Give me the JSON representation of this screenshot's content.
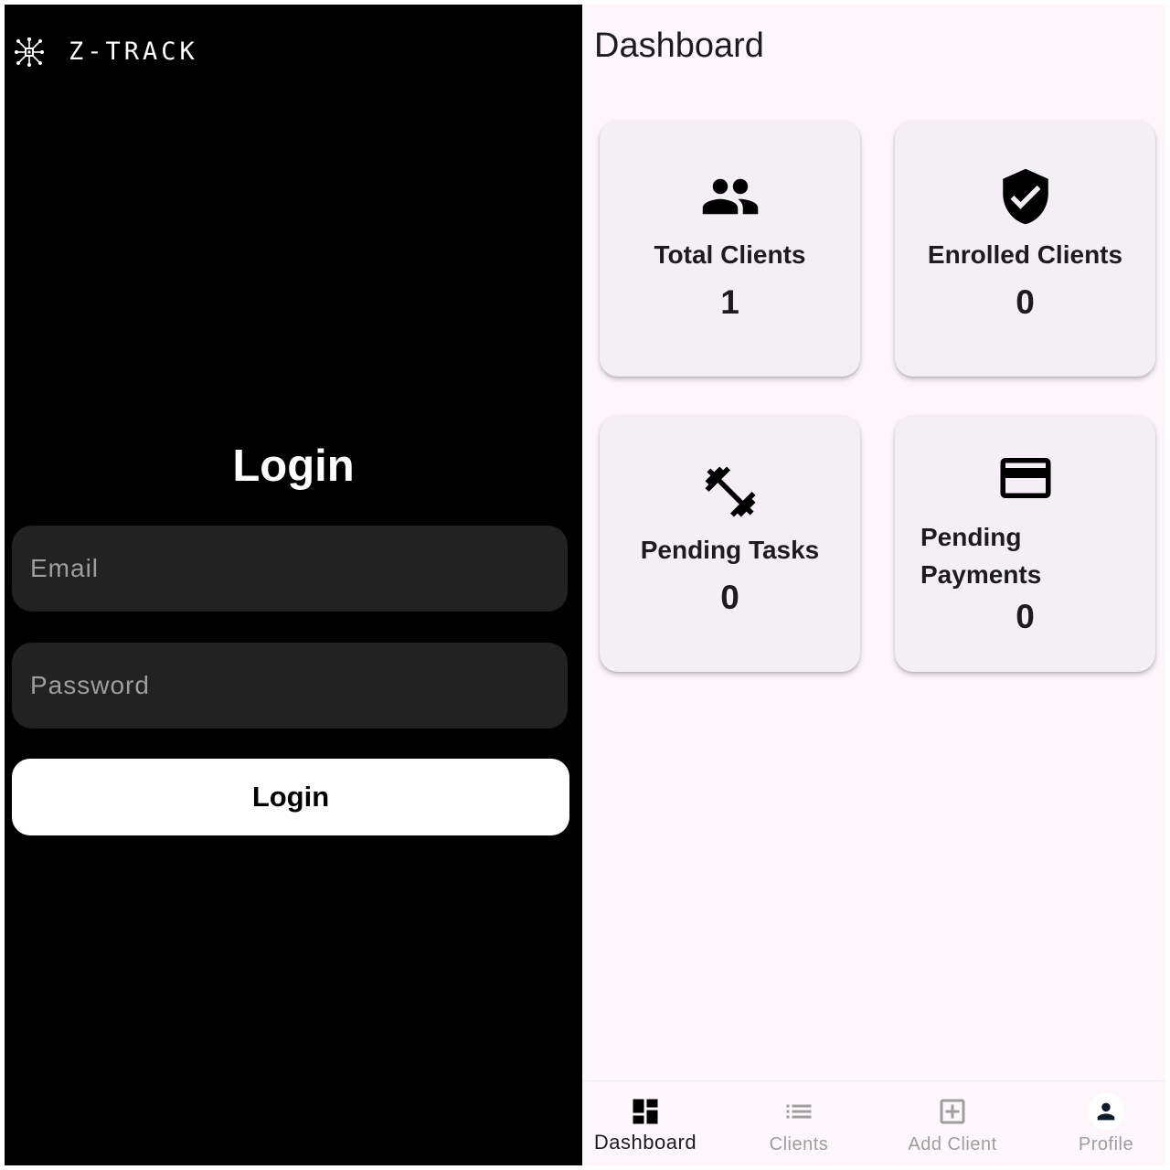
{
  "brand": {
    "name": "Z-TRACK",
    "logo_icon": "chip-network-logo"
  },
  "login": {
    "title": "Login",
    "email_placeholder": "Email",
    "password_placeholder": "Password",
    "button_label": "Login"
  },
  "dashboard": {
    "title": "Dashboard",
    "cards": [
      {
        "label": "Total Clients",
        "value": "1",
        "icon": "people-icon"
      },
      {
        "label": "Enrolled Clients",
        "value": "0",
        "icon": "verified-shield-icon"
      },
      {
        "label": "Pending Tasks",
        "value": "0",
        "icon": "dumbbell-icon"
      },
      {
        "label": "Pending Payments",
        "value": "0",
        "icon": "credit-card-icon"
      }
    ]
  },
  "nav": {
    "items": [
      {
        "label": "Dashboard",
        "icon": "dashboard-icon",
        "active": true
      },
      {
        "label": "Clients",
        "icon": "list-icon",
        "active": false
      },
      {
        "label": "Add Client",
        "icon": "add-box-icon",
        "active": false
      },
      {
        "label": "Profile",
        "icon": "person-icon",
        "active": false
      }
    ],
    "active_color": "#1c1b1f",
    "inactive_color": "#9e9e9e"
  },
  "colors": {
    "login_background": "#000000",
    "field_background": "#222222",
    "dashboard_background": "#fdf7fc",
    "card_background": "#f3eff4"
  }
}
